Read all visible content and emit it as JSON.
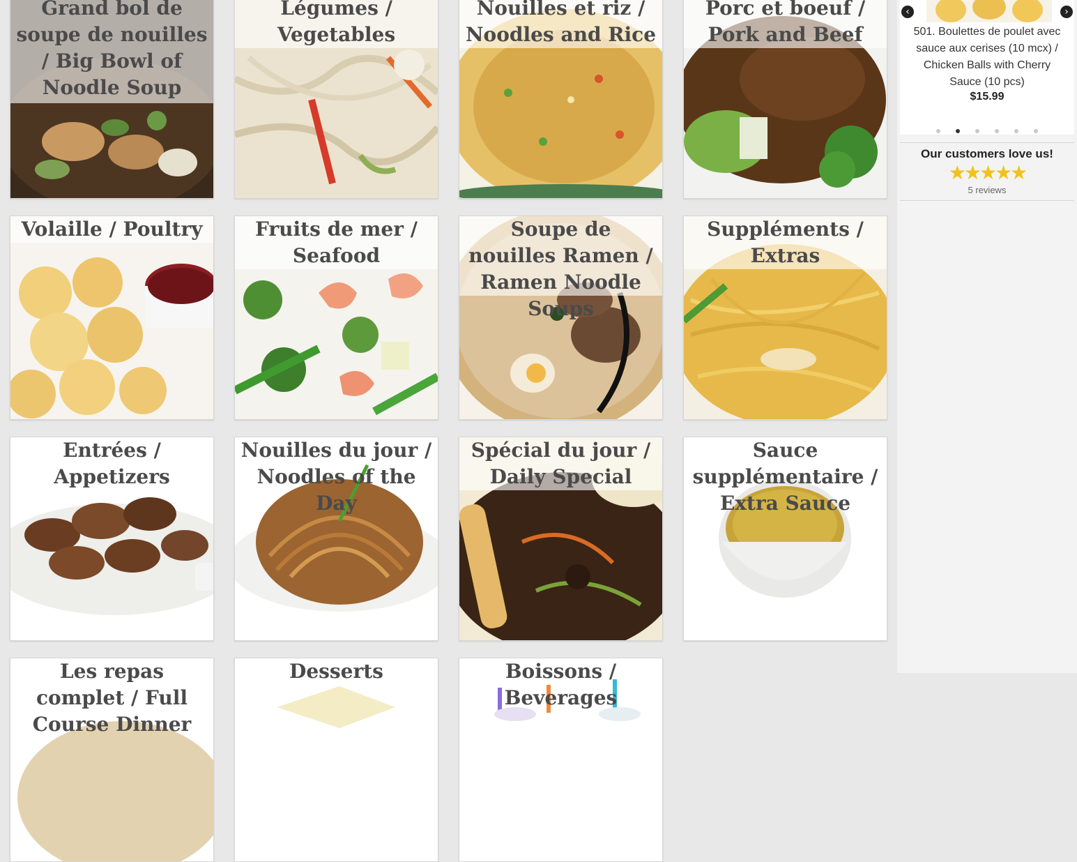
{
  "categories": [
    {
      "title": "Grand bol de soupe de nouilles / Big Bowl of Noodle Soup"
    },
    {
      "title": "Légumes / Vegetables"
    },
    {
      "title": "Nouilles et riz / Noodles and Rice"
    },
    {
      "title": "Porc et boeuf / Pork and Beef"
    },
    {
      "title": "Volaille / Poultry"
    },
    {
      "title": "Fruits de mer / Seafood"
    },
    {
      "title": "Soupe de nouilles Ramen / Ramen Noodle Soups"
    },
    {
      "title": "Suppléments / Extras"
    },
    {
      "title": "Entrées / Appetizers"
    },
    {
      "title": "Nouilles du jour / Noodles of the Day"
    },
    {
      "title": "Spécial du jour / Daily Special"
    },
    {
      "title": "Sauce supplémentaire / Extra Sauce"
    },
    {
      "title": "Les repas complet / Full Course Dinner"
    },
    {
      "title": "Desserts"
    },
    {
      "title": "Boissons / Beverages"
    }
  ],
  "featured": {
    "prev_icon": "chevron-left-icon",
    "next_icon": "chevron-right-icon",
    "item_name": "501. Boulettes de poulet avec sauce aux cerises (10 mcx) / Chicken Balls with Cherry Sauce (10 pcs)",
    "item_price": "$15.99",
    "slide_count": 6,
    "active_slide": 2
  },
  "reviews": {
    "title": "Our customers love us!",
    "rating_stars": 5,
    "count_label": "5 reviews"
  },
  "colors": {
    "background": "#e8e8e8",
    "title_text": "#4a4a4a",
    "star": "#f0c21c"
  }
}
